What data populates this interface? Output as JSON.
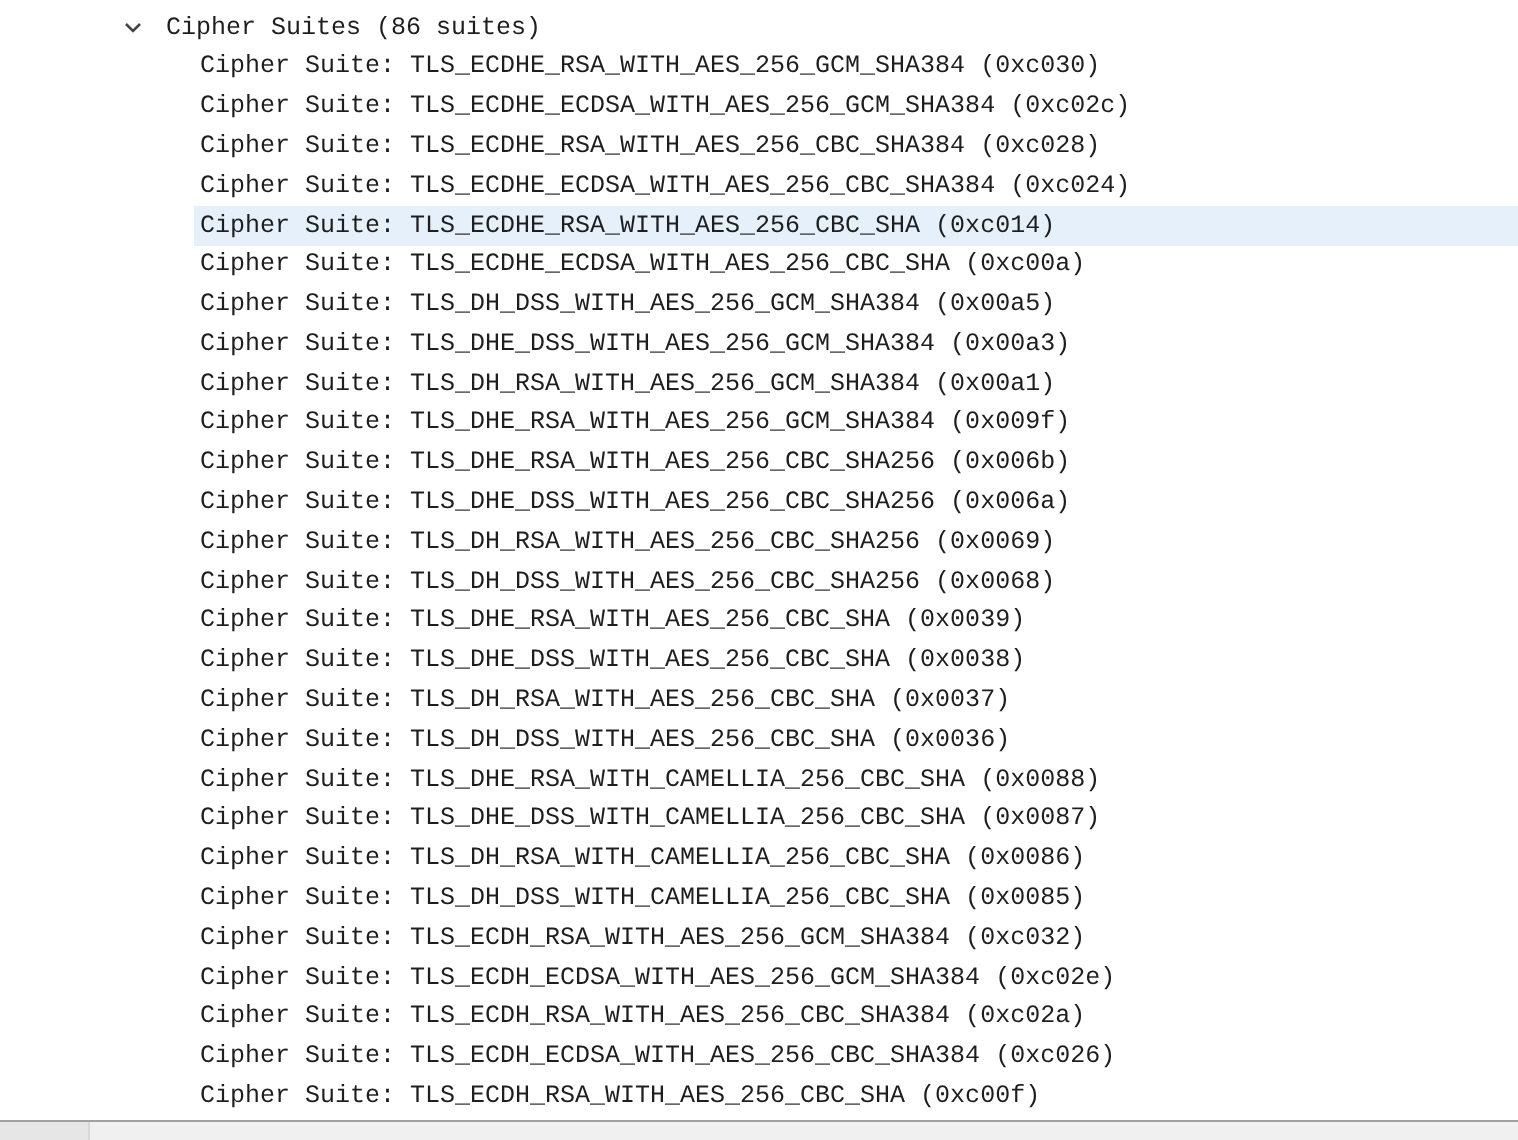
{
  "tree": [
    {
      "label": "Cipher Suites (86 suites)",
      "expanded": true,
      "children": [
        {
          "label": "Cipher Suite: TLS_ECDHE_RSA_WITH_AES_256_GCM_SHA384 (0xc030)",
          "selected": false
        },
        {
          "label": "Cipher Suite: TLS_ECDHE_ECDSA_WITH_AES_256_GCM_SHA384 (0xc02c)",
          "selected": false
        },
        {
          "label": "Cipher Suite: TLS_ECDHE_RSA_WITH_AES_256_CBC_SHA384 (0xc028)",
          "selected": false
        },
        {
          "label": "Cipher Suite: TLS_ECDHE_ECDSA_WITH_AES_256_CBC_SHA384 (0xc024)",
          "selected": false
        },
        {
          "label": "Cipher Suite: TLS_ECDHE_RSA_WITH_AES_256_CBC_SHA (0xc014)",
          "selected": true
        },
        {
          "label": "Cipher Suite: TLS_ECDHE_ECDSA_WITH_AES_256_CBC_SHA (0xc00a)",
          "selected": false
        },
        {
          "label": "Cipher Suite: TLS_DH_DSS_WITH_AES_256_GCM_SHA384 (0x00a5)",
          "selected": false
        },
        {
          "label": "Cipher Suite: TLS_DHE_DSS_WITH_AES_256_GCM_SHA384 (0x00a3)",
          "selected": false
        },
        {
          "label": "Cipher Suite: TLS_DH_RSA_WITH_AES_256_GCM_SHA384 (0x00a1)",
          "selected": false
        },
        {
          "label": "Cipher Suite: TLS_DHE_RSA_WITH_AES_256_GCM_SHA384 (0x009f)",
          "selected": false
        },
        {
          "label": "Cipher Suite: TLS_DHE_RSA_WITH_AES_256_CBC_SHA256 (0x006b)",
          "selected": false
        },
        {
          "label": "Cipher Suite: TLS_DHE_DSS_WITH_AES_256_CBC_SHA256 (0x006a)",
          "selected": false
        },
        {
          "label": "Cipher Suite: TLS_DH_RSA_WITH_AES_256_CBC_SHA256 (0x0069)",
          "selected": false
        },
        {
          "label": "Cipher Suite: TLS_DH_DSS_WITH_AES_256_CBC_SHA256 (0x0068)",
          "selected": false
        },
        {
          "label": "Cipher Suite: TLS_DHE_RSA_WITH_AES_256_CBC_SHA (0x0039)",
          "selected": false
        },
        {
          "label": "Cipher Suite: TLS_DHE_DSS_WITH_AES_256_CBC_SHA (0x0038)",
          "selected": false
        },
        {
          "label": "Cipher Suite: TLS_DH_RSA_WITH_AES_256_CBC_SHA (0x0037)",
          "selected": false
        },
        {
          "label": "Cipher Suite: TLS_DH_DSS_WITH_AES_256_CBC_SHA (0x0036)",
          "selected": false
        },
        {
          "label": "Cipher Suite: TLS_DHE_RSA_WITH_CAMELLIA_256_CBC_SHA (0x0088)",
          "selected": false
        },
        {
          "label": "Cipher Suite: TLS_DHE_DSS_WITH_CAMELLIA_256_CBC_SHA (0x0087)",
          "selected": false
        },
        {
          "label": "Cipher Suite: TLS_DH_RSA_WITH_CAMELLIA_256_CBC_SHA (0x0086)",
          "selected": false
        },
        {
          "label": "Cipher Suite: TLS_DH_DSS_WITH_CAMELLIA_256_CBC_SHA (0x0085)",
          "selected": false
        },
        {
          "label": "Cipher Suite: TLS_ECDH_RSA_WITH_AES_256_GCM_SHA384 (0xc032)",
          "selected": false
        },
        {
          "label": "Cipher Suite: TLS_ECDH_ECDSA_WITH_AES_256_GCM_SHA384 (0xc02e)",
          "selected": false
        },
        {
          "label": "Cipher Suite: TLS_ECDH_RSA_WITH_AES_256_CBC_SHA384 (0xc02a)",
          "selected": false
        },
        {
          "label": "Cipher Suite: TLS_ECDH_ECDSA_WITH_AES_256_CBC_SHA384 (0xc026)",
          "selected": false
        },
        {
          "label": "Cipher Suite: TLS_ECDH_RSA_WITH_AES_256_CBC_SHA (0xc00f)",
          "selected": false
        }
      ]
    }
  ]
}
